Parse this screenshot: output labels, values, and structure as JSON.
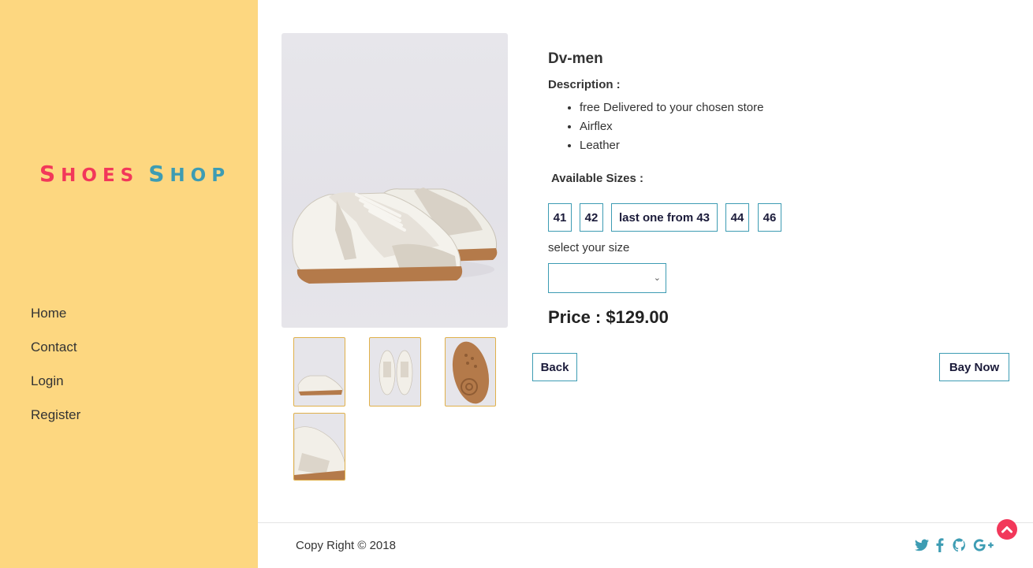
{
  "brand": {
    "word1_first": "S",
    "word1_rest": "hoes",
    "word2_first": "S",
    "word2_rest": "hop"
  },
  "nav": {
    "items": [
      "Home",
      "Contact",
      "Login",
      "Register"
    ]
  },
  "product": {
    "title": "Dv-men",
    "description_label": "Description :",
    "description_items": [
      "free Delivered to your chosen store",
      "Airflex",
      "Leather"
    ],
    "sizes_label": "Available Sizes :",
    "sizes": [
      "41",
      "42",
      "last one from 43",
      "44",
      "46"
    ],
    "select_label": "select your size",
    "select_value": "",
    "price": "Price : $129.00"
  },
  "actions": {
    "back": "Back",
    "buy": "Bay Now"
  },
  "footer": {
    "copyright": "Copy Right © 2018"
  },
  "icons": {
    "social": [
      "twitter-icon",
      "facebook-icon",
      "github-icon",
      "google-plus-icon"
    ],
    "scroll_top": "chevron-up-icon"
  },
  "colors": {
    "sidebar": "#fdd780",
    "brand_pink": "#f2385a",
    "brand_teal": "#3d9cb3",
    "thumb_border": "#e0b04a"
  }
}
